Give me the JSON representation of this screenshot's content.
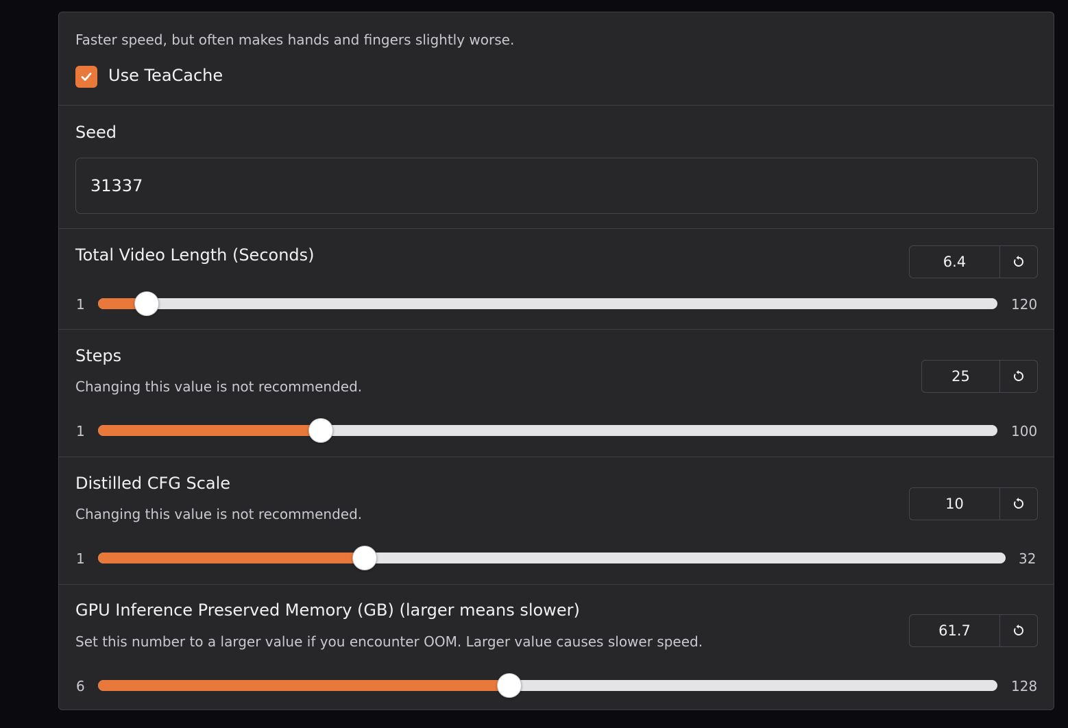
{
  "teacache": {
    "info": "Faster speed, but often makes hands and fingers slightly worse.",
    "label": "Use TeaCache",
    "checked": true
  },
  "seed": {
    "label": "Seed",
    "value": "31337"
  },
  "sliders": [
    {
      "id": "video-length",
      "label": "Total Video Length (Seconds)",
      "info": "",
      "value": "6.4",
      "min": "1",
      "max": "120",
      "fraction": 0.054
    },
    {
      "id": "steps",
      "label": "Steps",
      "info": "Changing this value is not recommended.",
      "value": "25",
      "min": "1",
      "max": "100",
      "fraction": 0.248
    },
    {
      "id": "cfg-scale",
      "label": "Distilled CFG Scale",
      "info": "Changing this value is not recommended.",
      "value": "10",
      "min": "1",
      "max": "32",
      "fraction": 0.294
    },
    {
      "id": "gpu-memory",
      "label": "GPU Inference Preserved Memory (GB) (larger means slower)",
      "info": "Set this number to a larger value if you encounter OOM. Larger value causes slower speed.",
      "value": "61.7",
      "min": "6",
      "max": "128",
      "fraction": 0.457
    }
  ],
  "icons": {
    "checkbox": "check-icon",
    "reset": "reset-icon"
  },
  "colors": {
    "accent": "#e8793a",
    "panel": "#27272a",
    "page": "#0b0b0f"
  }
}
